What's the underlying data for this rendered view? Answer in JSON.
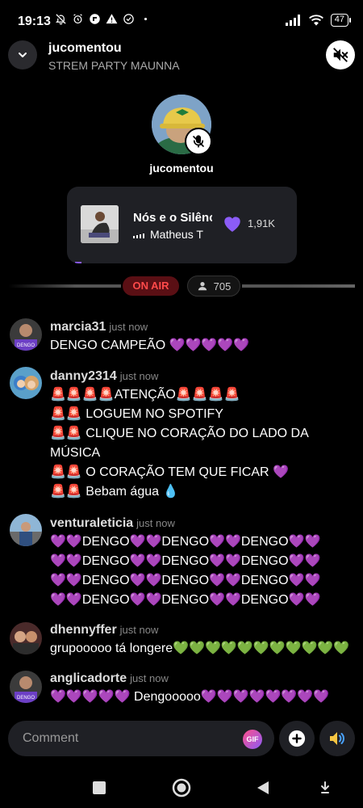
{
  "status_bar": {
    "time": "19:13",
    "left_icons": [
      "bell-off-icon",
      "alarm-icon",
      "app-icon",
      "warning-icon",
      "check-circle-icon",
      "dot-icon"
    ],
    "battery": "47"
  },
  "header": {
    "host": "jucomentou",
    "room_title": "STREM PARTY MAUNNA"
  },
  "host_speaker": {
    "name": "jucomentou"
  },
  "now_playing": {
    "title": "Nós e o Silêncio",
    "artist": "Matheus T",
    "likes": "1,91K"
  },
  "live": {
    "badge": "ON AIR",
    "viewers": "705"
  },
  "comments": [
    {
      "user": "marcia31",
      "time": "just now",
      "lines": [
        "DENGO CAMPEÃO 💜💜💜💜💜"
      ]
    },
    {
      "user": "danny2314",
      "time": "just now",
      "lines": [
        "🚨🚨🚨🚨ATENÇÃO🚨🚨🚨🚨",
        "🚨🚨 LOGUEM NO SPOTIFY",
        "🚨🚨 CLIQUE NO CORAÇÃO DO LADO DA",
        "MÚSICA",
        "🚨🚨 O CORAÇÃO TEM QUE FICAR 💜",
        "🚨🚨 Bebam água 💧"
      ]
    },
    {
      "user": "venturaleticia",
      "time": "just now",
      "lines": [
        "💜💜DENGO💜💜DENGO💜💜DENGO💜💜",
        "💜💜DENGO💜💜DENGO💜💜DENGO💜💜",
        "💜💜DENGO💜💜DENGO💜💜DENGO💜💜",
        "💜💜DENGO💜💜DENGO💜💜DENGO💜💜"
      ]
    },
    {
      "user": "dhennyffer",
      "time": "just now",
      "lines": [
        "grupooooo tá longere💚💚💚💚💚💚💚💚💚💚💚"
      ]
    },
    {
      "user": "anglicadorte",
      "time": "just now",
      "lines": [
        "💜💜💜💜💜 Dengooooo💜💜💜💜💜💜💜💜"
      ]
    }
  ],
  "composer": {
    "placeholder": "Comment",
    "gif_label": "GIF"
  },
  "colors": {
    "accent_purple": "#8b5cf6",
    "on_air_red": "#ff4a4a",
    "card_bg": "#1f2025"
  }
}
